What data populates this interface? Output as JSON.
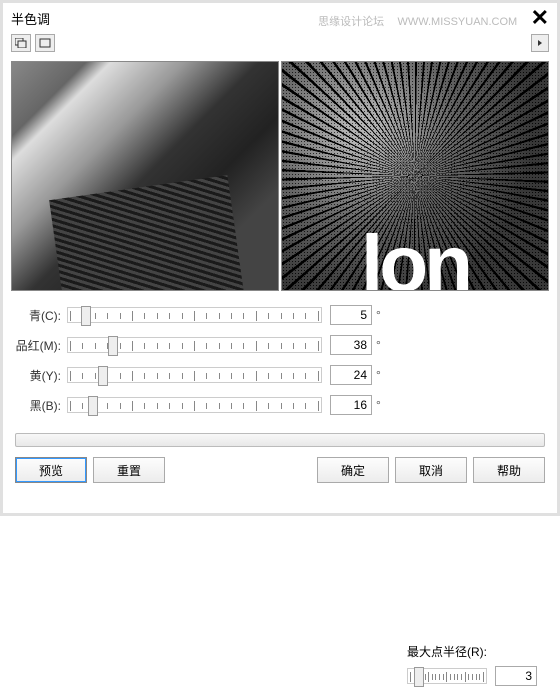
{
  "title": "半色调",
  "watermark_text": "思缘设计论坛",
  "watermark_url": "WWW.MISSYUAN.COM",
  "preview_text": "lon",
  "sliders": {
    "cyan": {
      "label": "青(C):",
      "value": "5",
      "unit": "°",
      "percent": 5
    },
    "magenta": {
      "label": "品红(M):",
      "value": "38",
      "unit": "°",
      "percent": 16
    },
    "yellow": {
      "label": "黄(Y):",
      "value": "24",
      "unit": "°",
      "percent": 12
    },
    "black": {
      "label": "黑(B):",
      "value": "16",
      "unit": "°",
      "percent": 8
    }
  },
  "radius": {
    "label": "最大点半径(R):",
    "value": "3",
    "percent": 8
  },
  "buttons": {
    "preview": "预览",
    "reset": "重置",
    "ok": "确定",
    "cancel": "取消",
    "help": "帮助"
  }
}
